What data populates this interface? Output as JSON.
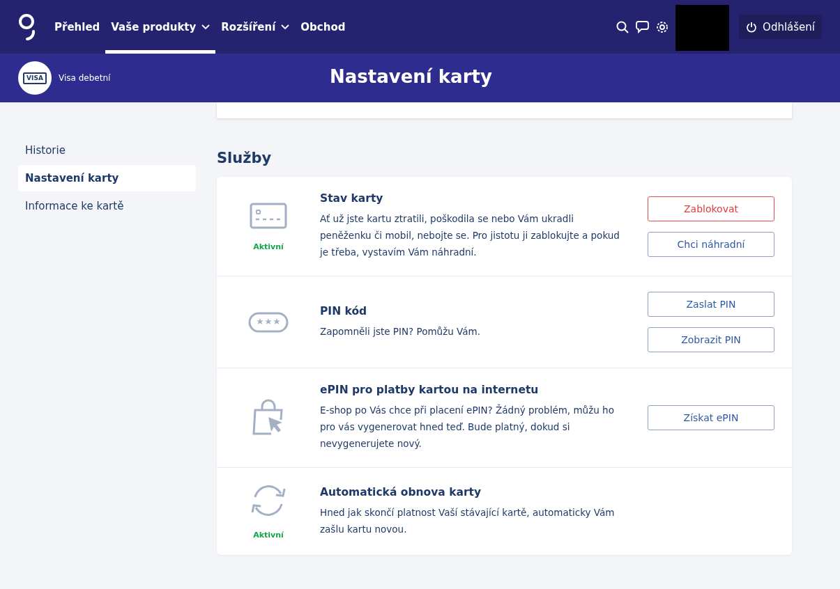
{
  "nav": {
    "items": [
      {
        "label": "Přehled",
        "selected": false,
        "dropdown": false
      },
      {
        "label": "Vaše produkty",
        "selected": true,
        "dropdown": true
      },
      {
        "label": "Rozšíření",
        "selected": false,
        "dropdown": true
      },
      {
        "label": "Obchod",
        "selected": false,
        "dropdown": false
      }
    ],
    "logout": "Odhlášení"
  },
  "product": {
    "name": "Visa debetní",
    "card_label": "VISA"
  },
  "page_title": "Nastavení karty",
  "sidebar": {
    "items": [
      {
        "label": "Historie",
        "selected": false
      },
      {
        "label": "Nastavení karty",
        "selected": true
      },
      {
        "label": "Informace ke kartě",
        "selected": false
      }
    ]
  },
  "services": {
    "title": "Služby",
    "items": [
      {
        "kind": "card",
        "title": "Stav karty",
        "text": "Ať už jste kartu ztratili, poškodila se nebo Vám ukradli peněženku či mobil, nebojte se. Pro jistotu ji zablokujte a pokud je třeba, vystavím Vám náhradní.",
        "status": "Aktivní",
        "buttons": [
          {
            "label": "Zablokovat",
            "kind": "danger"
          },
          {
            "label": "Chci náhradní",
            "kind": "default"
          }
        ]
      },
      {
        "kind": "pin",
        "title": "PIN kód",
        "text": "Zapomněli jste PIN? Pomůžu Vám.",
        "buttons": [
          {
            "label": "Zaslat PIN",
            "kind": "default"
          },
          {
            "label": "Zobrazit PIN",
            "kind": "default"
          }
        ]
      },
      {
        "kind": "shop",
        "title": "ePIN pro platby kartou na internetu",
        "text": "E-shop po Vás chce při placení ePIN? Žádný problém, můžu ho pro vás vygenerovat hned teď. Bude platný, dokud si nevygenerujete nový.",
        "buttons": [
          {
            "label": "Získat ePIN",
            "kind": "default"
          }
        ]
      },
      {
        "kind": "renew",
        "title": "Automatická obnova karty",
        "text": "Hned jak skončí platnost Vaší stávající kartě, automaticky Vám zašlu kartu novou.",
        "status": "Aktivní"
      }
    ]
  }
}
